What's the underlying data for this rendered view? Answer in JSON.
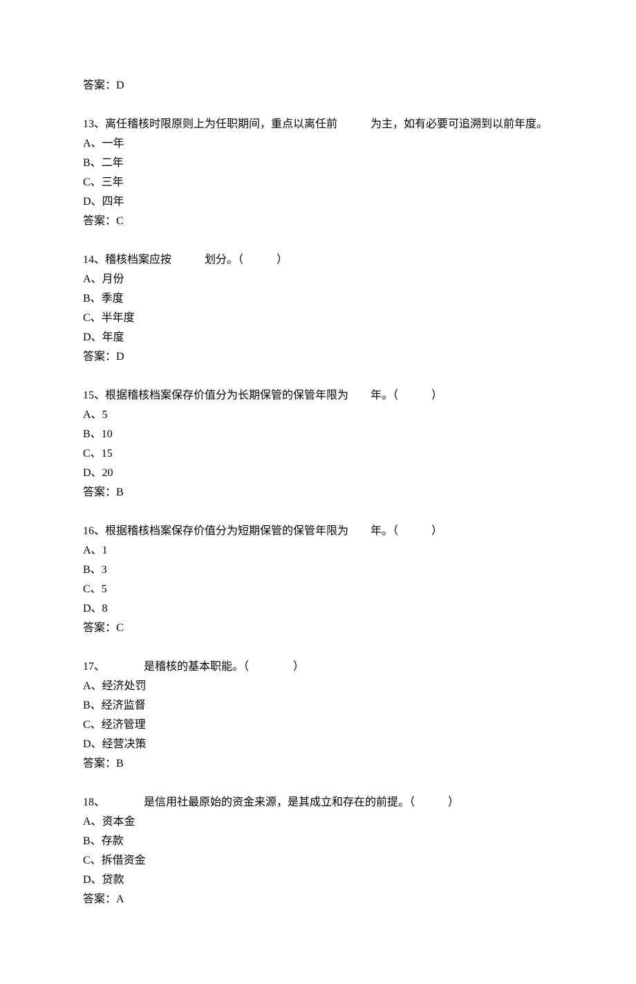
{
  "topAnswer": "答案：D",
  "questions": [
    {
      "stem": "13、离任稽核时限原则上为任职期间，重点以离任前　　　为主，如有必要可追溯到以前年度。",
      "options": [
        "A、一年",
        "B、二年",
        "C、三年",
        "D、四年"
      ],
      "answer": "答案：C"
    },
    {
      "stem": "14、稽核档案应按　　　划分。（　　　）",
      "options": [
        "A、月份",
        "B、季度",
        "C、半年度",
        "D、年度"
      ],
      "answer": "答案：D"
    },
    {
      "stem": "15、根据稽核档案保存价值分为长期保管的保管年限为　　年。（　　　）",
      "options": [
        "A、5",
        "B、10",
        "C、15",
        "D、20"
      ],
      "answer": "答案：B"
    },
    {
      "stem": "16、根据稽核档案保存价值分为短期保管的保管年限为　　年。（　　　）",
      "options": [
        "A、1",
        "B、3",
        "C、5",
        "D、8"
      ],
      "answer": "答案：C"
    },
    {
      "stem": "17、　　　　是稽核的基本职能。（　　　　）",
      "options": [
        "A、经济处罚",
        "B、经济监督",
        "C、经济管理",
        "D、经营决策"
      ],
      "answer": "答案：B"
    },
    {
      "stem": "18、　　　　是信用社最原始的资金来源，是其成立和存在的前提。（　　　）",
      "options": [
        "A、资本金",
        "B、存款",
        "C、拆借资金",
        "D、贷款"
      ],
      "answer": "答案：A"
    }
  ]
}
